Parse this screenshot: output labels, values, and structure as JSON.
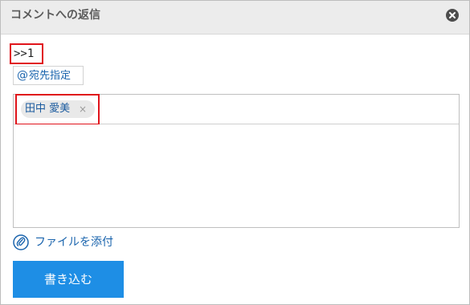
{
  "dialog": {
    "title": "コメントへの返信",
    "close_icon": "close-icon"
  },
  "reply": {
    "reference": ">>1"
  },
  "mention": {
    "at_symbol": "@",
    "label": "宛先指定"
  },
  "recipients": [
    {
      "name": "田中 愛美",
      "remove_symbol": "×"
    }
  ],
  "editor": {
    "body": ""
  },
  "attachment": {
    "icon": "paperclip-icon",
    "label": "ファイルを添付"
  },
  "actions": {
    "submit_label": "書き込む"
  },
  "colors": {
    "accent": "#1e8ee5",
    "link": "#1a64ad",
    "highlight": "#e0141b",
    "header_bg": "#ececec"
  }
}
